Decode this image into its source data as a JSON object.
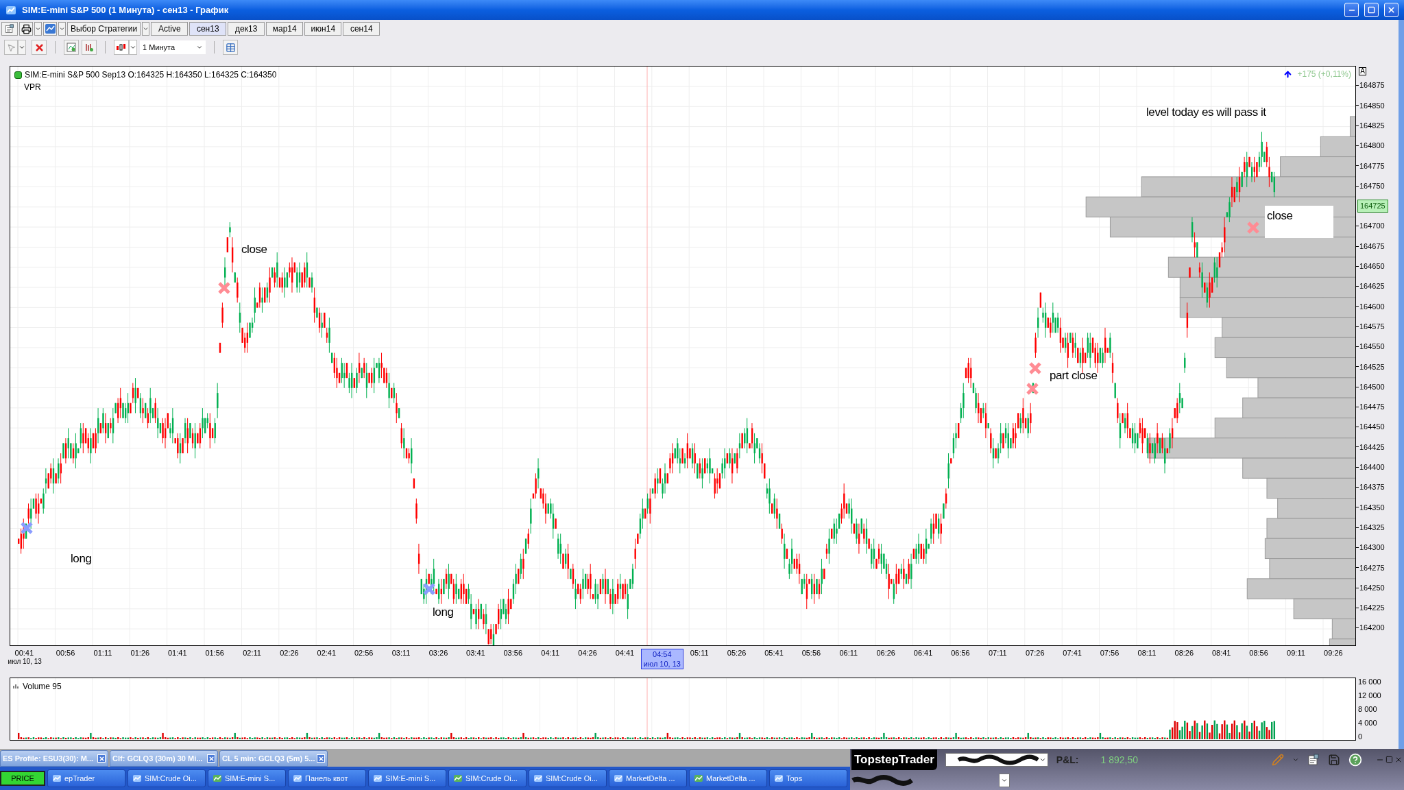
{
  "window": {
    "title": "SIM:E-mini S&P 500 (1 Минута) - сен13 - График"
  },
  "toolbar": {
    "strategy_dropdown": "Выбор Стратегии",
    "tabs": [
      {
        "label": "Active",
        "selected": false
      },
      {
        "label": "сен13",
        "selected": true
      },
      {
        "label": "дек13",
        "selected": false
      },
      {
        "label": "мар14",
        "selected": false
      },
      {
        "label": "июн14",
        "selected": false
      },
      {
        "label": "сен14",
        "selected": false
      }
    ],
    "interval": "1 Минута"
  },
  "chart": {
    "instrument_line": "SIM:E-mini S&P 500 Sep13 O:164325 H:164350 L:164325 C:164350",
    "indicator": "VPR",
    "change": "+175 (+0,11%)",
    "autoscale": "A",
    "price_labels": [
      {
        "label": "164875",
        "kind": "tick"
      },
      {
        "label": "164850",
        "kind": "tick"
      },
      {
        "label": "164825",
        "kind": "tick"
      },
      {
        "label": "164800",
        "kind": "tick"
      },
      {
        "label": "164775",
        "kind": "tick"
      },
      {
        "label": "164750",
        "kind": "tick"
      },
      {
        "label": "164725",
        "kind": "current"
      },
      {
        "label": "164700",
        "kind": "tick"
      },
      {
        "label": "164675",
        "kind": "tick"
      },
      {
        "label": "164650",
        "kind": "tick"
      },
      {
        "label": "164625",
        "kind": "tick"
      },
      {
        "label": "164600",
        "kind": "tick"
      },
      {
        "label": "164575",
        "kind": "tick"
      },
      {
        "label": "164550",
        "kind": "tick"
      },
      {
        "label": "164525",
        "kind": "tick"
      },
      {
        "label": "164500",
        "kind": "tick"
      },
      {
        "label": "164475",
        "kind": "tick"
      },
      {
        "label": "164450",
        "kind": "tick"
      },
      {
        "label": "164425",
        "kind": "tick"
      },
      {
        "label": "164400",
        "kind": "tick"
      },
      {
        "label": "164375",
        "kind": "tick"
      },
      {
        "label": "164350",
        "kind": "tick"
      },
      {
        "label": "164325",
        "kind": "tick"
      },
      {
        "label": "164300",
        "kind": "tick"
      },
      {
        "label": "164275",
        "kind": "tick"
      },
      {
        "label": "164250",
        "kind": "tick"
      },
      {
        "label": "164225",
        "kind": "tick"
      },
      {
        "label": "164200",
        "kind": "tick"
      }
    ],
    "time_labels": [
      {
        "label": "00:41",
        "kind": "tick"
      },
      {
        "label": "00:56",
        "kind": "tick"
      },
      {
        "label": "01:11",
        "kind": "tick"
      },
      {
        "label": "01:26",
        "kind": "tick"
      },
      {
        "label": "01:41",
        "kind": "tick"
      },
      {
        "label": "01:56",
        "kind": "tick"
      },
      {
        "label": "02:11",
        "kind": "tick"
      },
      {
        "label": "02:26",
        "kind": "tick"
      },
      {
        "label": "02:41",
        "kind": "tick"
      },
      {
        "label": "02:56",
        "kind": "tick"
      },
      {
        "label": "03:11",
        "kind": "tick"
      },
      {
        "label": "03:26",
        "kind": "tick"
      },
      {
        "label": "03:41",
        "kind": "tick"
      },
      {
        "label": "03:56",
        "kind": "tick"
      },
      {
        "label": "04:11",
        "kind": "tick"
      },
      {
        "label": "04:26",
        "kind": "tick"
      },
      {
        "label": "04:41",
        "kind": "tick"
      },
      {
        "label": "04:54",
        "kind": "cursor",
        "date": "июл 10, 13"
      },
      {
        "label": "05:11",
        "kind": "tick"
      },
      {
        "label": "05:26",
        "kind": "tick"
      },
      {
        "label": "05:41",
        "kind": "tick"
      },
      {
        "label": "05:56",
        "kind": "tick"
      },
      {
        "label": "06:11",
        "kind": "tick"
      },
      {
        "label": "06:26",
        "kind": "tick"
      },
      {
        "label": "06:41",
        "kind": "tick"
      },
      {
        "label": "06:56",
        "kind": "tick"
      },
      {
        "label": "07:11",
        "kind": "tick"
      },
      {
        "label": "07:26",
        "kind": "tick"
      },
      {
        "label": "07:41",
        "kind": "tick"
      },
      {
        "label": "07:56",
        "kind": "tick"
      },
      {
        "label": "08:11",
        "kind": "tick"
      },
      {
        "label": "08:26",
        "kind": "tick"
      },
      {
        "label": "08:41",
        "kind": "tick"
      },
      {
        "label": "08:56",
        "kind": "tick"
      },
      {
        "label": "09:11",
        "kind": "tick"
      },
      {
        "label": "09:26",
        "kind": "tick"
      }
    ],
    "axis_date": "июл 10, 13",
    "annotations": [
      {
        "text": "close",
        "boxed": false
      },
      {
        "text": "long",
        "boxed": false
      },
      {
        "text": "long",
        "boxed": false
      },
      {
        "text": "part close",
        "boxed": false
      },
      {
        "text": "close",
        "boxed": true
      },
      {
        "text": "level today es will pass it",
        "boxed": false
      }
    ],
    "markers": [
      {
        "color": "#ff8c94"
      },
      {
        "color": "#8a9cff"
      },
      {
        "color": "#8a9cff"
      },
      {
        "color": "#ff8c94"
      },
      {
        "color": "#ff8c94"
      },
      {
        "color": "#ff8c94"
      }
    ]
  },
  "volume_panel": {
    "title": "Volume 95",
    "axis_labels": [
      "16 000",
      "12 000",
      "8 000",
      "4 000",
      "0"
    ]
  },
  "document_tabs": [
    "ES Profile: ESU3(30): M...",
    "Clf: GCLQ3 (30m) 30 Mi...",
    "CL 5 min: GCLQ3 (5m) 5..."
  ],
  "taskbar": {
    "price_button": "PRICE",
    "items": [
      "epTrader",
      "SIM:Crude Oi...",
      "SIM:E-mini S...",
      "Панель квот",
      "SIM:E-mini S...",
      "SIM:Crude Oi...",
      "SIM:Crude Oi...",
      "MarketDelta ...",
      "MarketDelta ...",
      "Tops"
    ]
  },
  "topstep": {
    "brand": "TopstepTrader",
    "pnl_label": "P&L:",
    "pnl_value": "1 892,50"
  }
}
